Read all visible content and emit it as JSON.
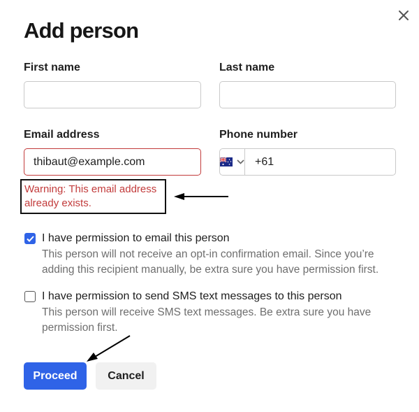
{
  "dialog": {
    "title": "Add person",
    "close_icon": "close-icon"
  },
  "form": {
    "first_name": {
      "label": "First name",
      "value": "",
      "placeholder": ""
    },
    "last_name": {
      "label": "Last name",
      "value": "",
      "placeholder": ""
    },
    "email": {
      "label": "Email address",
      "value": "thibaut@example.com",
      "placeholder": ""
    },
    "phone": {
      "label": "Phone number",
      "country_flag": "australia-flag-icon",
      "value": "+61"
    },
    "email_warning_line1": "Warning: This email address",
    "email_warning_line2": "already exists."
  },
  "permissions": {
    "email": {
      "checked": true,
      "label": "I have permission to email this person",
      "desc_line1": "This person will not receive an opt-in confirmation email. Since you’re",
      "desc_line2": "adding this recipient manually, be extra sure you have permission first."
    },
    "sms": {
      "checked": false,
      "label": "I have permission to send SMS text messages to this person",
      "desc_line1": "This person will receive SMS text messages. Be extra sure you have",
      "desc_line2": "permission first."
    }
  },
  "actions": {
    "proceed": "Proceed",
    "cancel": "Cancel"
  },
  "colors": {
    "primary": "#2f63e7",
    "error": "#c23b3b",
    "muted_text": "#6e6e6e"
  }
}
